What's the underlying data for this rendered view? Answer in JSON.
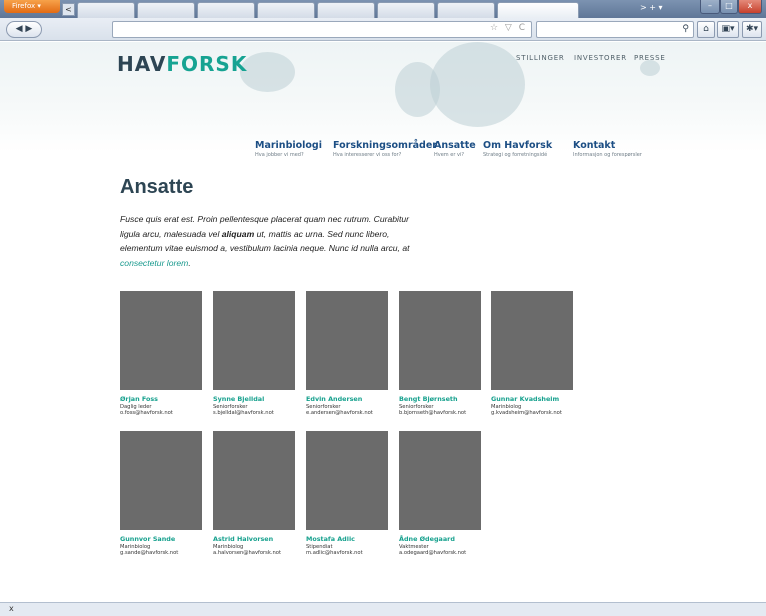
{
  "browser": {
    "app_label": "Firefox ▾",
    "tab_scroll_glyph": "<",
    "right_glyphs": ">  +  ▾",
    "back_forward_glyph": "◀ ▶",
    "url_icons": "☆ ▽ C",
    "search_glyph": "⚲",
    "home_glyph": "⌂",
    "bookmarks_glyph": "▣▾",
    "addons_glyph": "✱▾",
    "close_glyph": "x"
  },
  "site": {
    "logo_part1": "HAV",
    "logo_part2": "FORSK",
    "topnav": [
      "STILLINGER",
      "INVESTORER",
      "PRESSE"
    ],
    "mainnav": [
      {
        "label": "Marinbiologi",
        "sub": "Hva jobber vi med?"
      },
      {
        "label": "Forskningsområder",
        "sub": "Hva interesserer vi oss for?"
      },
      {
        "label": "Ansatte",
        "sub": "Hvem er vi?"
      },
      {
        "label": "Om Havforsk",
        "sub": "Strategi og forretningsidé"
      },
      {
        "label": "Kontakt",
        "sub": "Informasjon og forespørsler"
      }
    ]
  },
  "content": {
    "heading": "Ansatte",
    "intro_1": "Fusce quis erat est. Proin pellentesque placerat quam nec rutrum. Curabitur ligula arcu, malesuada vel ",
    "intro_bold": "aliquam",
    "intro_2": " ut, mattis ac urna. Sed nunc libero, elementum vitae euismod a, vestibulum lacinia neque. Nunc id nulla arcu, at ",
    "intro_link": "consectetur lorem",
    "intro_3": "."
  },
  "employees": [
    {
      "name": "Ørjan Foss",
      "role": "Daglig leder",
      "email": "o.foss@havforsk.not"
    },
    {
      "name": "Synne Bjelldal",
      "role": "Seniorforsker",
      "email": "s.bjelldal@havforsk.not"
    },
    {
      "name": "Edvin Andersen",
      "role": "Seniorforsker",
      "email": "e.andersen@havforsk.not"
    },
    {
      "name": "Bengt Bjørnseth",
      "role": "Seniorforsker",
      "email": "b.bjornseth@havforsk.not"
    },
    {
      "name": "Gunnar Kvadsheim",
      "role": "Marinbiolog",
      "email": "g.kvadsheim@havforsk.not"
    },
    {
      "name": "Gunnvor Sande",
      "role": "Marinbiolog",
      "email": "g.sande@havforsk.not"
    },
    {
      "name": "Astrid Halvorsen",
      "role": "Marinbiolog",
      "email": "a.halvorsen@havforsk.not"
    },
    {
      "name": "Mostafa Adlic",
      "role": "Stipendiat",
      "email": "m.adlic@havforsk.not"
    },
    {
      "name": "Ådne Ødegaard",
      "role": "Vaktmester",
      "email": "a.odegaard@havforsk.not"
    }
  ],
  "colors": {
    "accent": "#16a392",
    "nav": "#1c4e84",
    "heading": "#2d4553",
    "photo_placeholder": "#6b6b6b"
  }
}
